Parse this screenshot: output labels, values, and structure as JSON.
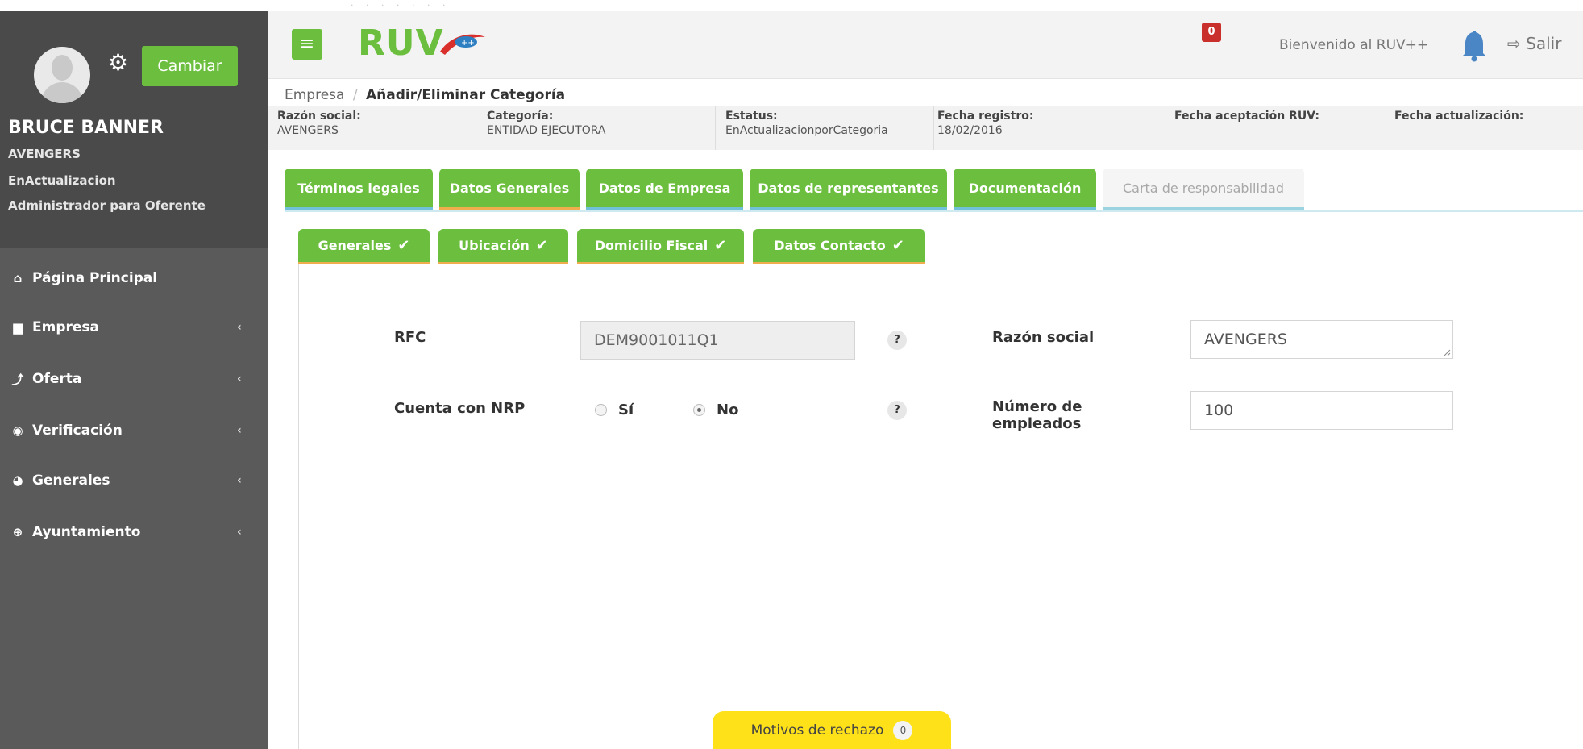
{
  "sidebar": {
    "change_button": "Cambiar",
    "user_name": "BRUCE BANNER",
    "user_company": "AVENGERS",
    "user_status": "EnActualizacion",
    "user_role": "Administrador para Oferente",
    "nav": [
      {
        "label": "Página Principal",
        "icon": "home-icon"
      },
      {
        "label": "Empresa",
        "icon": "building-icon"
      },
      {
        "label": "Oferta",
        "icon": "chart-icon"
      },
      {
        "label": "Verificación",
        "icon": "circle-icon"
      },
      {
        "label": "Generales",
        "icon": "dashboard-icon"
      },
      {
        "label": "Ayuntamiento",
        "icon": "plus-circle-icon"
      }
    ]
  },
  "header": {
    "logo_text": "RUV",
    "welcome": "Bienvenido al RUV++",
    "notifications": "0",
    "logout": "Salir"
  },
  "breadcrumb": {
    "parent": "Empresa",
    "separator": "/",
    "current": "Añadir/Eliminar Categoría"
  },
  "info": [
    {
      "label": "Razón social:",
      "value": "AVENGERS"
    },
    {
      "label": "Categoría:",
      "value": "ENTIDAD EJECUTORA"
    },
    {
      "label": "Estatus:",
      "value": "EnActualizacionporCategoria"
    },
    {
      "label": "Fecha registro:",
      "value": "18/02/2016"
    },
    {
      "label": "Fecha aceptación RUV:",
      "value": ""
    },
    {
      "label": "Fecha actualización:",
      "value": ""
    }
  ],
  "tabs": [
    "Términos legales",
    "Datos Generales",
    "Datos de Empresa",
    "Datos de representantes",
    "Documentación",
    "Carta de responsabilidad"
  ],
  "subtabs": [
    "Generales",
    "Ubicación",
    "Domicilio Fiscal",
    "Datos Contacto"
  ],
  "form": {
    "rfc_label": "RFC",
    "rfc_value": "DEM9001011Q1",
    "razon_label": "Razón social",
    "razon_value": "AVENGERS",
    "nrp_label": "Cuenta con NRP",
    "nrp_si": "Sí",
    "nrp_no": "No",
    "nrp_selected": "No",
    "empleados_label_1": "Número de",
    "empleados_label_2": "empleados",
    "empleados_value": "100",
    "help": "?"
  },
  "motivos": {
    "label": "Motivos de rechazo",
    "count": "0"
  },
  "colors": {
    "accent_green": "#6cbf3e",
    "sidebar": "#5a5a5a",
    "active_tab_underline": "#f0ad4e",
    "motivos_yellow": "#ffe11a",
    "badge_red": "#c9302c"
  }
}
